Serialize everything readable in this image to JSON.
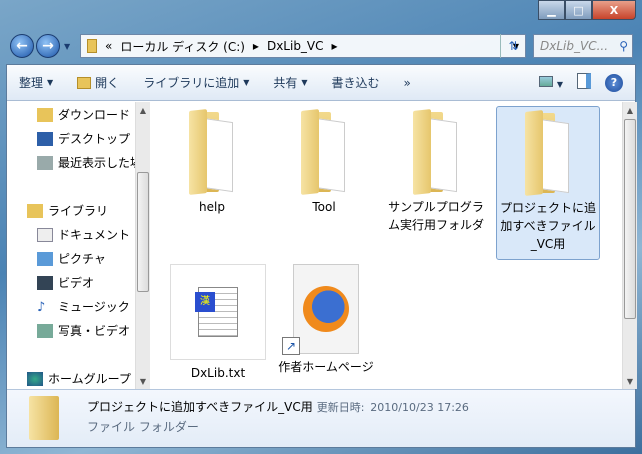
{
  "window": {
    "minimize": "▁",
    "maximize": "□",
    "close": "X"
  },
  "nav": {
    "back": "←",
    "forward": "→"
  },
  "address": {
    "overflow": "«",
    "crumbs": [
      "ローカル ディスク (C:)",
      "DxLib_VC"
    ],
    "sep": "▸"
  },
  "search": {
    "placeholder": "DxLib_VC..."
  },
  "toolbar": {
    "organize": "整理",
    "open": "開く",
    "add_library": "ライブラリに追加",
    "share": "共有",
    "burn": "書き込む",
    "more": "»",
    "help": "?"
  },
  "sidebar": {
    "items": [
      {
        "label": "ダウンロード",
        "icon": "download-folder-icon"
      },
      {
        "label": "デスクトップ",
        "icon": "desktop-icon"
      },
      {
        "label": "最近表示した場所",
        "icon": "recent-places-icon"
      },
      {
        "label": "ライブラリ",
        "icon": "library-icon"
      },
      {
        "label": "ドキュメント",
        "icon": "documents-icon"
      },
      {
        "label": "ピクチャ",
        "icon": "pictures-icon"
      },
      {
        "label": "ビデオ",
        "icon": "videos-icon"
      },
      {
        "label": "ミュージック",
        "icon": "music-icon"
      },
      {
        "label": "写真・ビデオ",
        "icon": "photos-icon"
      },
      {
        "label": "ホームグループ",
        "icon": "homegroup-icon"
      }
    ]
  },
  "files": [
    {
      "name": "help",
      "type": "folder"
    },
    {
      "name": "Tool",
      "type": "folder"
    },
    {
      "name": "サンプルプログラム実行用フォルダ",
      "type": "folder"
    },
    {
      "name": "プロジェクトに追加すべきファイル_VC用",
      "type": "folder",
      "selected": true
    },
    {
      "name": "DxLib.txt",
      "type": "text"
    },
    {
      "name": "作者ホームページ",
      "type": "shortcut"
    }
  ],
  "details": {
    "name": "プロジェクトに追加すべきファイル_VC用",
    "modified_label": "更新日時:",
    "modified": "2010/10/23 17:26",
    "type": "ファイル フォルダー"
  }
}
